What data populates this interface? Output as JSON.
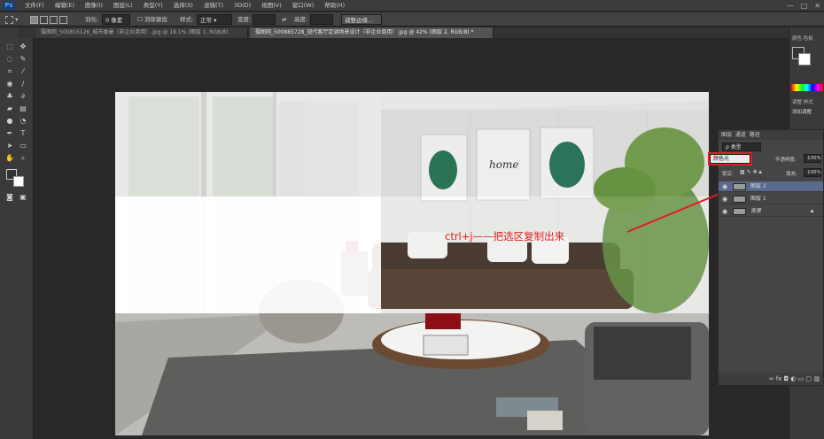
{
  "app": {
    "logo": "Ps"
  },
  "menu": [
    "文件(F)",
    "编辑(E)",
    "图像(I)",
    "图层(L)",
    "类型(Y)",
    "选择(S)",
    "滤镜(T)",
    "3D(D)",
    "视图(V)",
    "窗口(W)",
    "帮助(H)"
  ],
  "window_controls": [
    "—",
    "□",
    "✕"
  ],
  "options": {
    "feather_label": "羽化:",
    "feather_value": "0 像素",
    "antialias_label": "消除锯齿",
    "style_label": "样式:",
    "style_value": "正常",
    "width_label": "宽度:",
    "height_label": "高度:",
    "refine_label": "调整边缘..."
  },
  "tabs": [
    {
      "label": "摄图网_500815126_城市香暑（非企业商用）.jpg @ 19.1% (图层 1, RGB/8)",
      "active": false
    },
    {
      "label": "摄图网_500885728_现代客厅定调场景设计（非企业商用）.jpg @ 42% (图层 2, RGB/8) *",
      "active": true
    }
  ],
  "panels": {
    "swatch_tabs": [
      "颜色",
      "色板"
    ],
    "adjust_tabs": [
      "调整",
      "样式"
    ],
    "adjust_label": "添加调整",
    "layers_tabs": [
      "图层",
      "通道",
      "路径"
    ],
    "kind_label": "ρ 类型",
    "blend_mode": "颜色光",
    "opacity_label": "不透明度:",
    "opacity_value": "100%",
    "lock_label": "锁定:",
    "fill_label": "填充:",
    "fill_value": "100%",
    "layers": [
      {
        "name": "图层 2",
        "selected": true
      },
      {
        "name": "图层 1",
        "selected": false
      },
      {
        "name": "背景",
        "selected": false
      }
    ]
  },
  "annotation": {
    "text": "ctrl+j——把选区复制出来",
    "color": "#e02020"
  },
  "artwork": {
    "poster_text": "home"
  },
  "colors": {
    "selection_box": "#e02020",
    "layer_selected": "#5a6a8c"
  }
}
